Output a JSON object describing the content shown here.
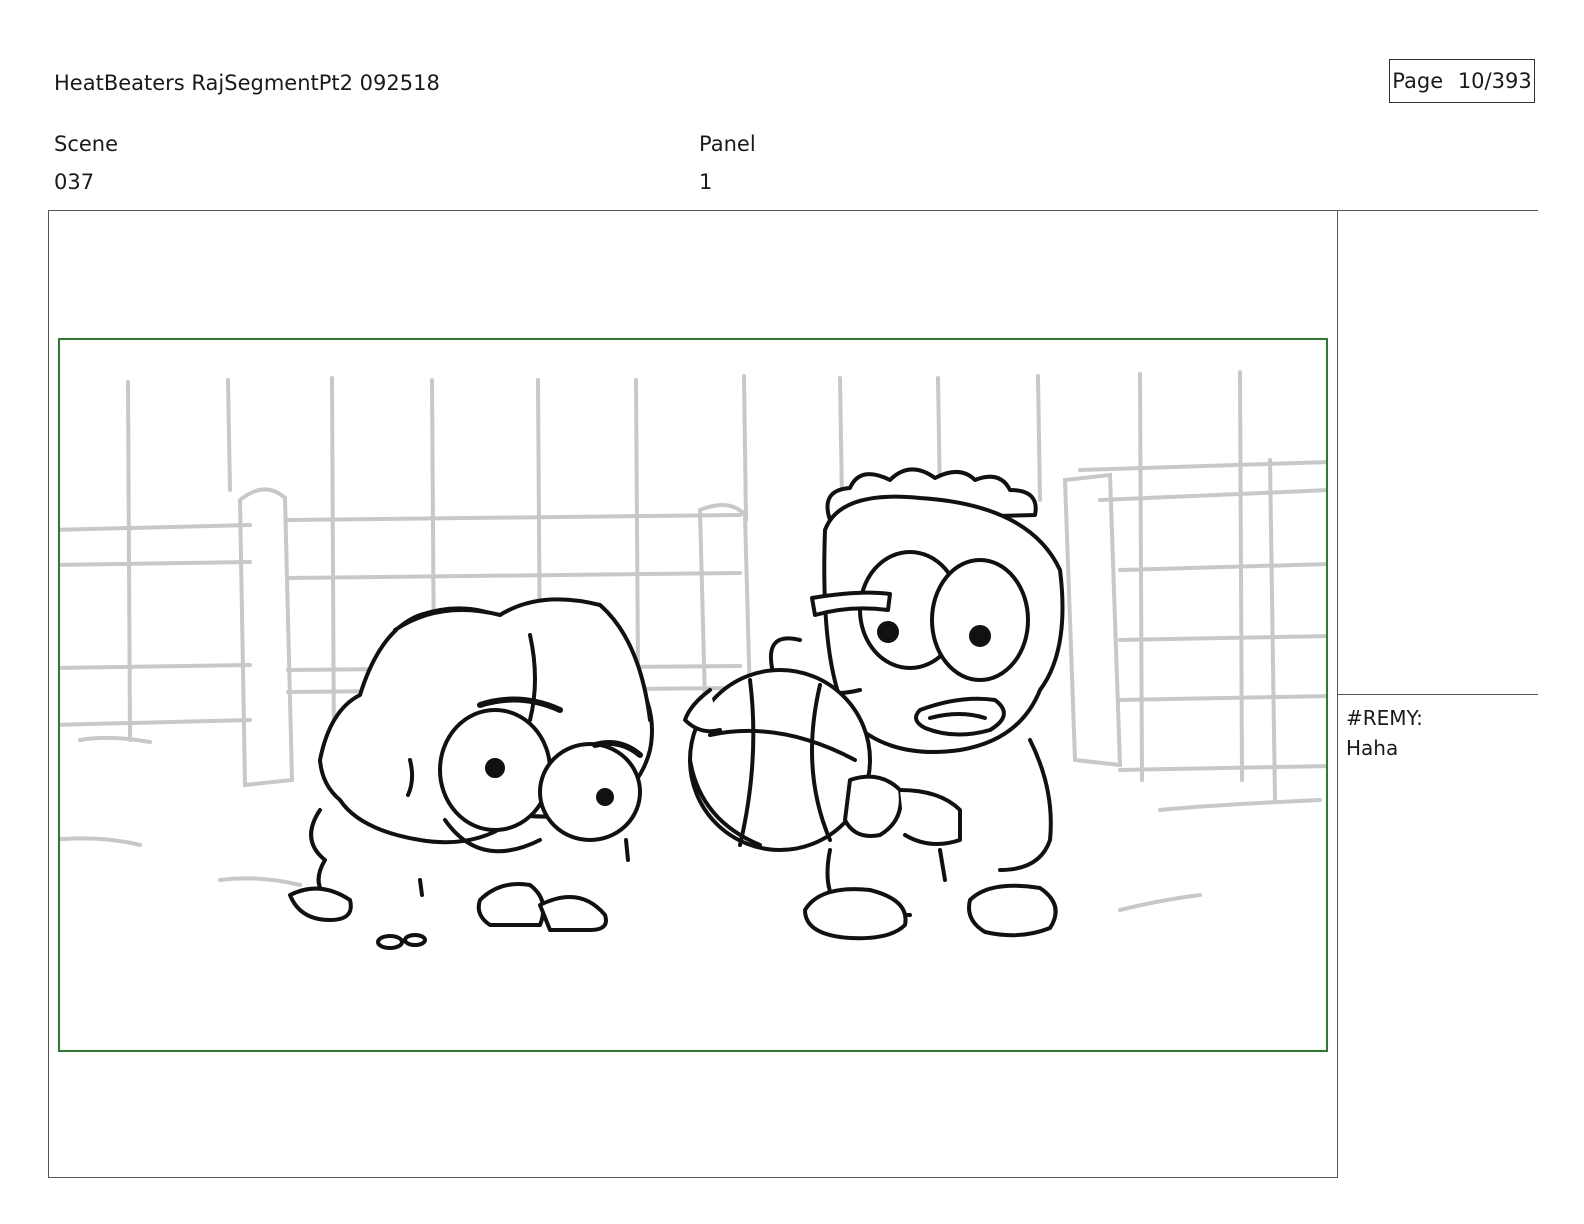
{
  "header": {
    "project_title": "HeatBeaters RajSegmentPt2 092518",
    "page_label": "Page",
    "page_value": "10/393"
  },
  "fields": {
    "scene_label": "Scene",
    "scene_value": "037",
    "panel_label": "Panel",
    "panel_value": "1"
  },
  "notes": {
    "dialogue_speaker": "#REMY:",
    "dialogue_line": "Haha"
  },
  "colors": {
    "safe_area_border": "#2e7a2e",
    "sketch_background": "#c8c8c8",
    "sketch_ink": "#111111"
  }
}
